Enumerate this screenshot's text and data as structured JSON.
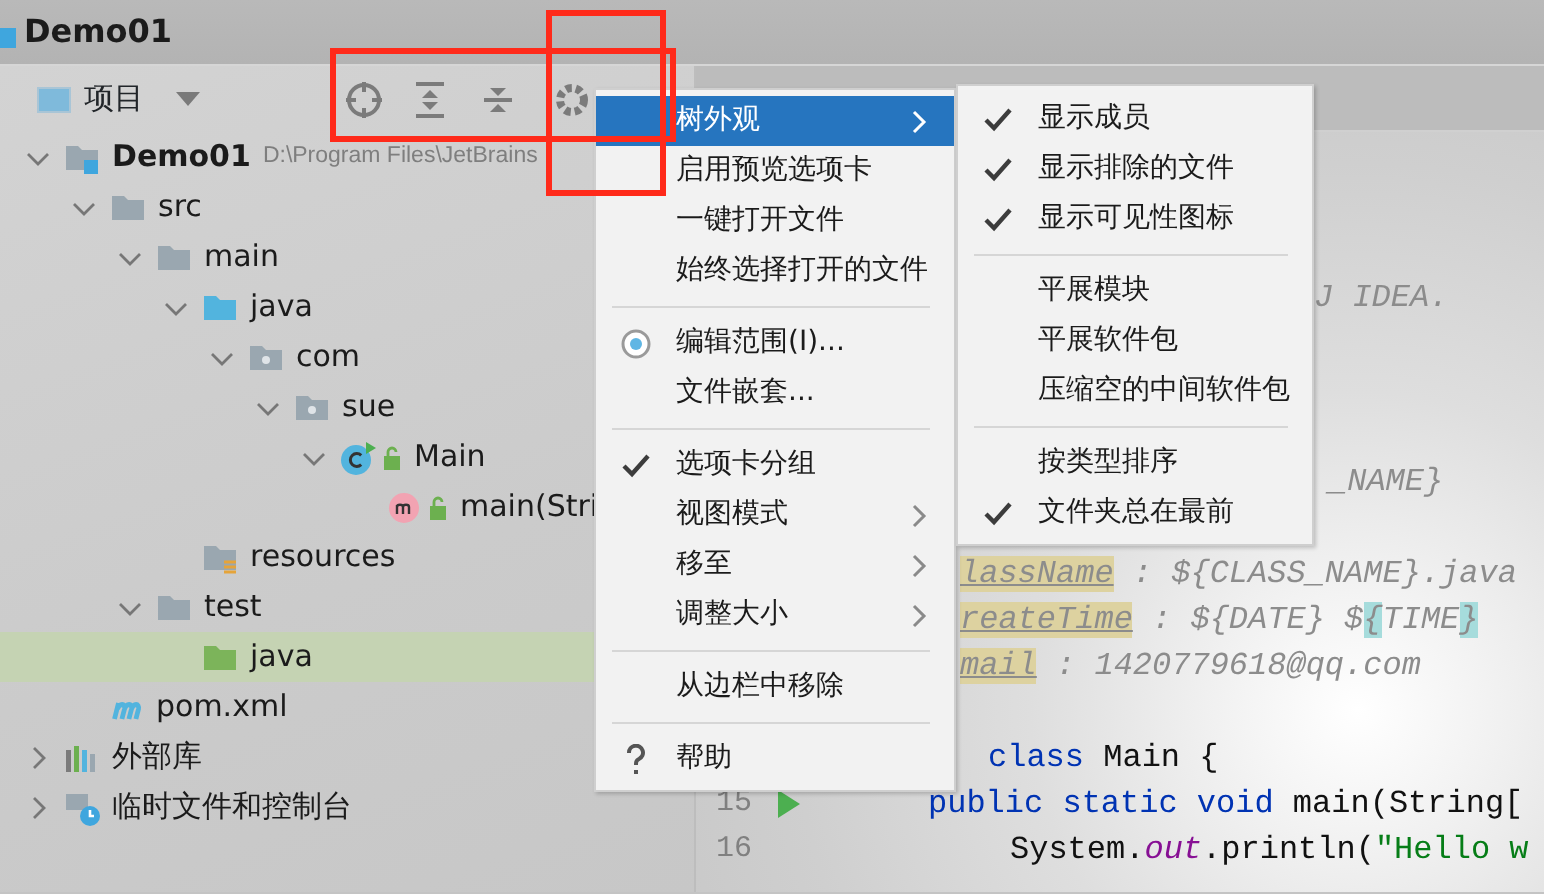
{
  "window": {
    "title": "Demo01"
  },
  "project_panel": {
    "view_label": "项目"
  },
  "tree": [
    {
      "kind": "module",
      "label": "Demo01",
      "path": "D:\\Program Files\\JetBrains",
      "expanded": true,
      "selected": false,
      "children": [
        {
          "kind": "folder",
          "label": "src",
          "expanded": true,
          "selected": false,
          "children": [
            {
              "kind": "folder",
              "label": "main",
              "expanded": true,
              "selected": false,
              "children": [
                {
                  "kind": "source-root",
                  "label": "java",
                  "expanded": true,
                  "selected": false,
                  "children": [
                    {
                      "kind": "package",
                      "label": "com",
                      "expanded": true,
                      "selected": false,
                      "children": [
                        {
                          "kind": "package",
                          "label": "sue",
                          "expanded": true,
                          "selected": false,
                          "children": [
                            {
                              "kind": "class",
                              "label": "Main",
                              "expanded": true,
                              "selected": false,
                              "children": [
                                {
                                  "kind": "method",
                                  "label": "main(Stri",
                                  "selected": false
                                }
                              ]
                            }
                          ]
                        }
                      ]
                    }
                  ]
                },
                {
                  "kind": "resources-root",
                  "label": "resources",
                  "selected": false
                }
              ]
            },
            {
              "kind": "folder",
              "label": "test",
              "expanded": true,
              "selected": false,
              "children": [
                {
                  "kind": "test-root",
                  "label": "java",
                  "selected": true
                }
              ]
            }
          ]
        },
        {
          "kind": "maven",
          "label": "pom.xml",
          "selected": false
        }
      ]
    },
    {
      "kind": "libraries",
      "label": "外部库",
      "expanded": false,
      "selected": false
    },
    {
      "kind": "scratches",
      "label": "临时文件和控制台",
      "expanded": false,
      "selected": false
    }
  ],
  "editor": {
    "lines": [
      {
        "segments": [
          {
            "kind": "comment",
            "text": "J IDEA."
          }
        ]
      },
      {
        "segments": [
          {
            "kind": "comment",
            "text": "_NAME}"
          }
        ]
      },
      {
        "segments": [
          {
            "kind": "tag",
            "text": "lassName"
          },
          {
            "kind": "comment",
            "text": " : ${CLASS_NAME}.java"
          }
        ]
      },
      {
        "segments": [
          {
            "kind": "tag",
            "text": "reateTime"
          },
          {
            "kind": "comment",
            "text": " : ${DATE} $"
          },
          {
            "kind": "brace",
            "text": "{"
          },
          {
            "kind": "comment",
            "text": "TIME"
          },
          {
            "kind": "brace",
            "text": "}"
          }
        ]
      },
      {
        "segments": [
          {
            "kind": "tag",
            "text": "mail"
          },
          {
            "kind": "comment",
            "text": " : 1420779618@qq.com"
          }
        ]
      },
      {
        "segments": [
          {
            "kind": "keyword",
            "text": "class"
          },
          {
            "kind": "plain",
            "text": " Main {"
          }
        ]
      },
      {
        "number": "15",
        "runnable": true,
        "segments": [
          {
            "kind": "keyword",
            "text": "public static void"
          },
          {
            "kind": "plain",
            "text": " main(String["
          }
        ]
      },
      {
        "number": "16",
        "segments": [
          {
            "kind": "plain",
            "text": "System."
          },
          {
            "kind": "field",
            "text": "out"
          },
          {
            "kind": "plain",
            "text": ".println("
          },
          {
            "kind": "string",
            "text": "\"Hello w"
          }
        ]
      }
    ]
  },
  "context_menu": {
    "items": [
      {
        "kind": "item",
        "label": "树外观",
        "submenu": true,
        "selected": true
      },
      {
        "kind": "item",
        "label": "启用预览选项卡",
        "submenu": false,
        "selected": false
      },
      {
        "kind": "item",
        "label": "一键打开文件",
        "submenu": false,
        "selected": false
      },
      {
        "kind": "item",
        "label": "始终选择打开的文件",
        "submenu": false,
        "selected": false
      },
      {
        "kind": "separator"
      },
      {
        "kind": "scope",
        "label": "编辑范围(I)...",
        "submenu": false,
        "selected": false
      },
      {
        "kind": "item",
        "label": "文件嵌套...",
        "submenu": false,
        "selected": false
      },
      {
        "kind": "separator"
      },
      {
        "kind": "item",
        "label": "选项卡分组",
        "submenu": false,
        "selected": false,
        "checked": true
      },
      {
        "kind": "item",
        "label": "视图模式",
        "submenu": true,
        "selected": false
      },
      {
        "kind": "item",
        "label": "移至",
        "submenu": true,
        "selected": false
      },
      {
        "kind": "item",
        "label": "调整大小",
        "submenu": true,
        "selected": false
      },
      {
        "kind": "separator"
      },
      {
        "kind": "item",
        "label": "从边栏中移除",
        "submenu": false,
        "selected": false
      },
      {
        "kind": "separator"
      },
      {
        "kind": "help",
        "label": "帮助",
        "submenu": false,
        "selected": false
      }
    ]
  },
  "submenu": {
    "items": [
      {
        "kind": "item",
        "label": "显示成员",
        "checked": true
      },
      {
        "kind": "item",
        "label": "显示排除的文件",
        "checked": true
      },
      {
        "kind": "item",
        "label": "显示可见性图标",
        "checked": true
      },
      {
        "kind": "separator"
      },
      {
        "kind": "item",
        "label": "平展模块",
        "checked": false
      },
      {
        "kind": "item",
        "label": "平展软件包",
        "checked": false
      },
      {
        "kind": "item",
        "label": "压缩空的中间软件包",
        "checked": false
      },
      {
        "kind": "separator"
      },
      {
        "kind": "item",
        "label": "按类型排序",
        "checked": false
      },
      {
        "kind": "item",
        "label": "文件夹总在最前",
        "checked": true
      }
    ]
  },
  "annotations": [
    {
      "kind": "box"
    },
    {
      "kind": "box"
    }
  ]
}
